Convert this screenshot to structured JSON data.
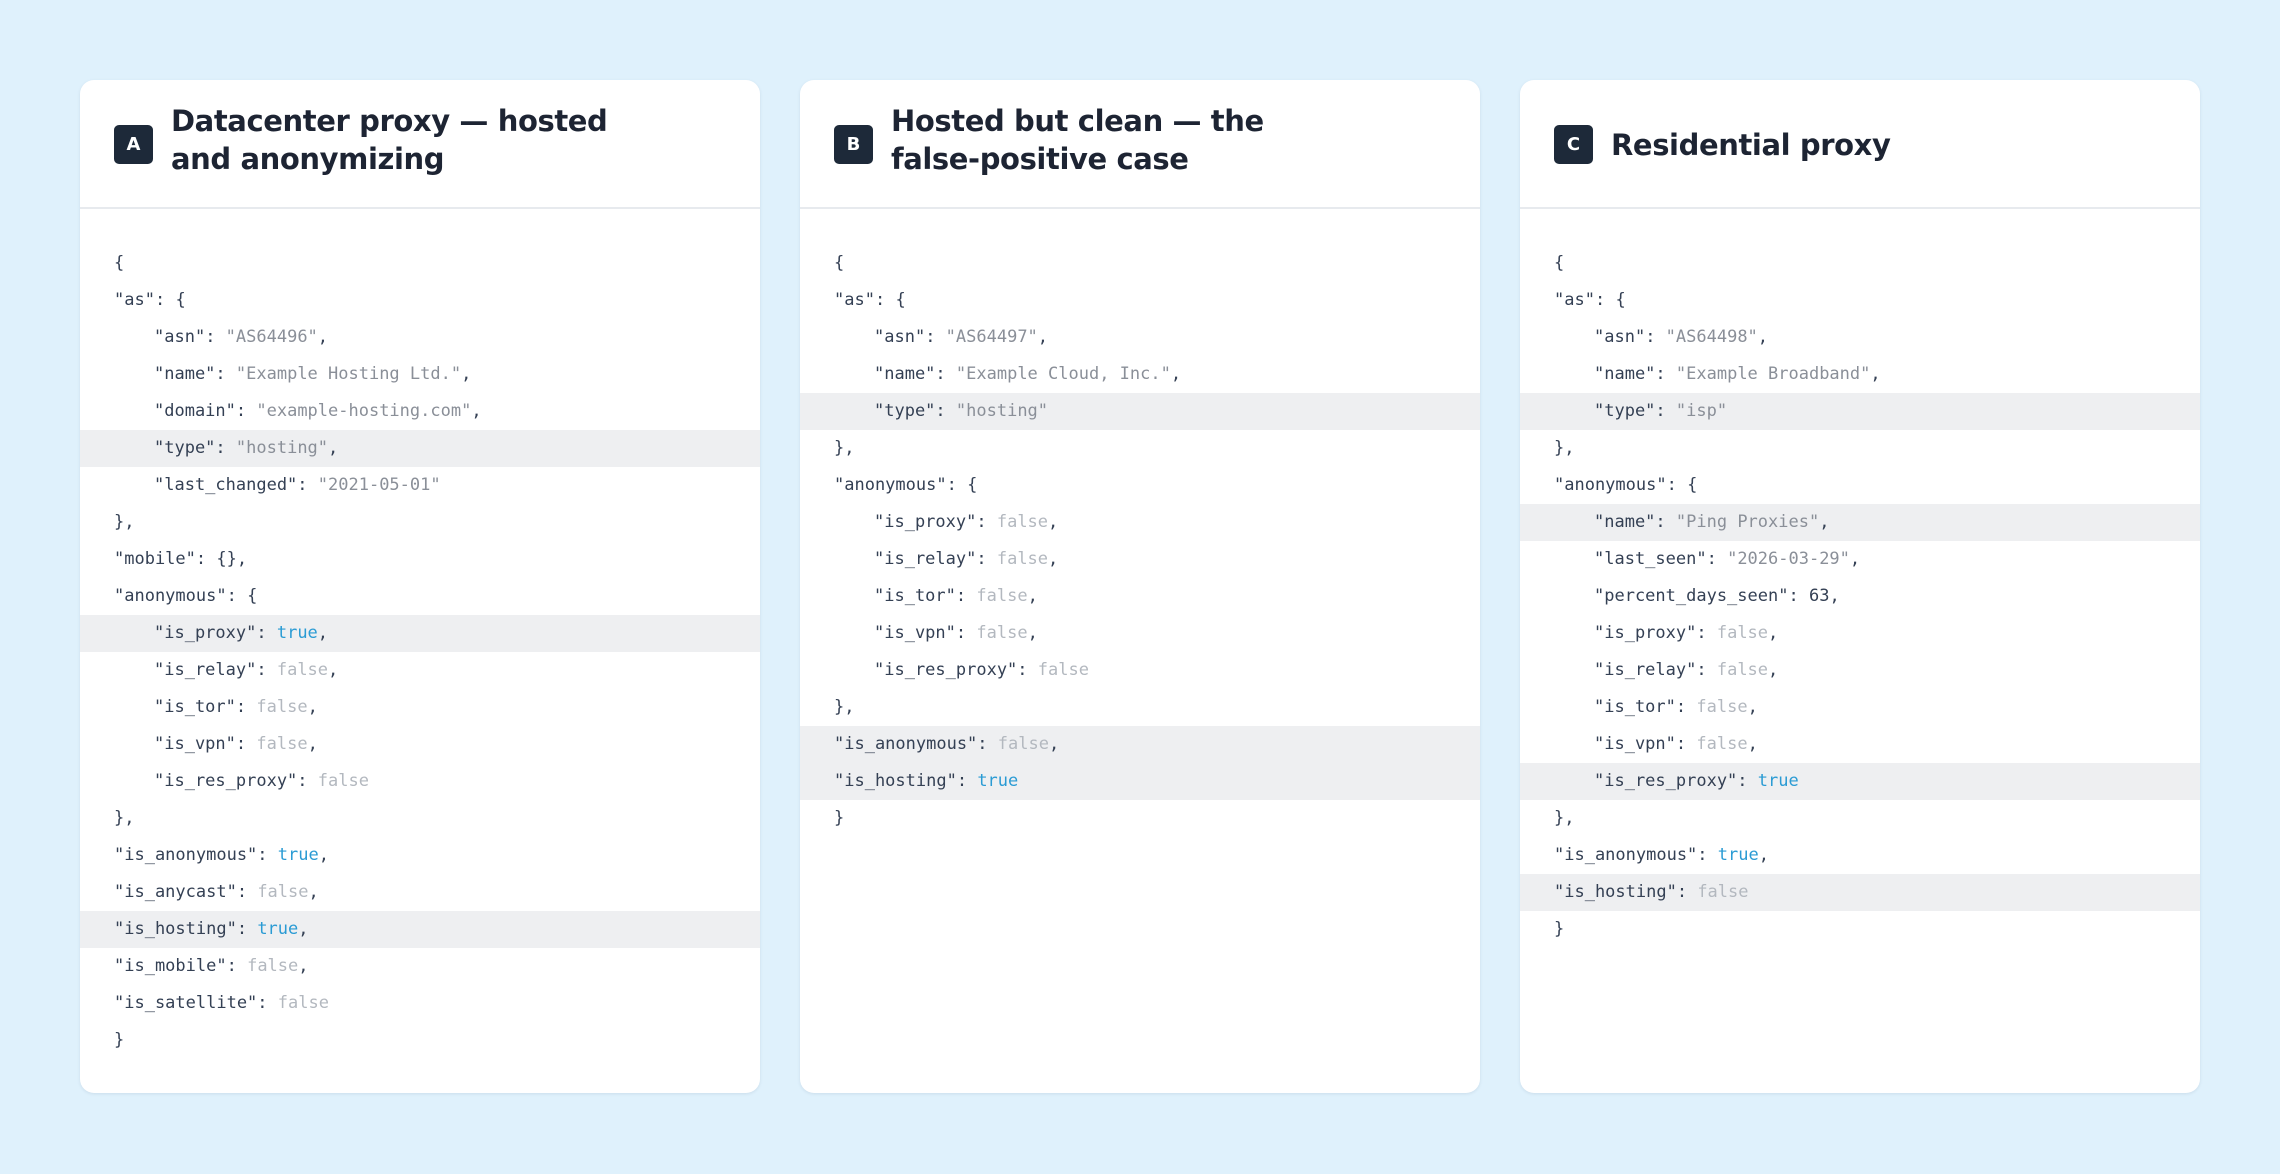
{
  "colors": {
    "background": "#dff1fc",
    "card": "#ffffff",
    "badge": "#1d2939",
    "highlight": "#eeeff1",
    "key": "#344054",
    "string": "#8a8f98",
    "true": "#2a9bd4",
    "false": "#b3b8bf"
  },
  "cards": [
    {
      "badge": "A",
      "title_lines": [
        "Datacenter proxy — hosted",
        "and anonymizing"
      ],
      "lines": [
        {
          "indent": 0,
          "hl": false,
          "key": "",
          "value": "",
          "vtype": "",
          "text": "{"
        },
        {
          "indent": 0,
          "hl": false,
          "key": "\"as\"",
          "value": "",
          "vtype": "",
          "text": "{"
        },
        {
          "indent": 1,
          "hl": false,
          "key": "\"asn\"",
          "value": "\"AS64496\"",
          "vtype": "string",
          "text": ","
        },
        {
          "indent": 1,
          "hl": false,
          "key": "\"name\"",
          "value": "\"Example Hosting Ltd.\"",
          "vtype": "string",
          "text": ","
        },
        {
          "indent": 1,
          "hl": false,
          "key": "\"domain\"",
          "value": "\"example-hosting.com\"",
          "vtype": "string",
          "text": ","
        },
        {
          "indent": 1,
          "hl": true,
          "key": "\"type\"",
          "value": "\"hosting\"",
          "vtype": "string",
          "text": ","
        },
        {
          "indent": 1,
          "hl": false,
          "key": "\"last_changed\"",
          "value": "\"2021-05-01\"",
          "vtype": "string",
          "text": ""
        },
        {
          "indent": 0,
          "hl": false,
          "key": "",
          "value": "",
          "vtype": "",
          "text": "},"
        },
        {
          "indent": 0,
          "hl": false,
          "key": "\"mobile\"",
          "value": "",
          "vtype": "",
          "text": "{},"
        },
        {
          "indent": 0,
          "hl": false,
          "key": "\"anonymous\"",
          "value": "",
          "vtype": "",
          "text": "{"
        },
        {
          "indent": 1,
          "hl": true,
          "key": "\"is_proxy\"",
          "value": "true",
          "vtype": "true",
          "text": ","
        },
        {
          "indent": 1,
          "hl": false,
          "key": "\"is_relay\"",
          "value": "false",
          "vtype": "false",
          "text": ","
        },
        {
          "indent": 1,
          "hl": false,
          "key": "\"is_tor\"",
          "value": "false",
          "vtype": "false",
          "text": ","
        },
        {
          "indent": 1,
          "hl": false,
          "key": "\"is_vpn\"",
          "value": "false",
          "vtype": "false",
          "text": ","
        },
        {
          "indent": 1,
          "hl": false,
          "key": "\"is_res_proxy\"",
          "value": "false",
          "vtype": "false",
          "text": ""
        },
        {
          "indent": 0,
          "hl": false,
          "key": "",
          "value": "",
          "vtype": "",
          "text": "},"
        },
        {
          "indent": 0,
          "hl": false,
          "key": "\"is_anonymous\"",
          "value": "true",
          "vtype": "true",
          "text": ","
        },
        {
          "indent": 0,
          "hl": false,
          "key": "\"is_anycast\"",
          "value": "false",
          "vtype": "false",
          "text": ","
        },
        {
          "indent": 0,
          "hl": true,
          "key": "\"is_hosting\"",
          "value": "true",
          "vtype": "true",
          "text": ","
        },
        {
          "indent": 0,
          "hl": false,
          "key": "\"is_mobile\"",
          "value": "false",
          "vtype": "false",
          "text": ","
        },
        {
          "indent": 0,
          "hl": false,
          "key": "\"is_satellite\"",
          "value": "false",
          "vtype": "false",
          "text": ""
        },
        {
          "indent": 0,
          "hl": false,
          "key": "",
          "value": "",
          "vtype": "",
          "text": "}"
        }
      ]
    },
    {
      "badge": "B",
      "title_lines": [
        "Hosted but clean — the",
        "false-positive case"
      ],
      "lines": [
        {
          "indent": 0,
          "hl": false,
          "key": "",
          "value": "",
          "vtype": "",
          "text": "{"
        },
        {
          "indent": 0,
          "hl": false,
          "key": "\"as\"",
          "value": "",
          "vtype": "",
          "text": "{"
        },
        {
          "indent": 1,
          "hl": false,
          "key": "\"asn\"",
          "value": "\"AS64497\"",
          "vtype": "string",
          "text": ","
        },
        {
          "indent": 1,
          "hl": false,
          "key": "\"name\"",
          "value": "\"Example Cloud, Inc.\"",
          "vtype": "string",
          "text": ","
        },
        {
          "indent": 1,
          "hl": true,
          "key": "\"type\"",
          "value": "\"hosting\"",
          "vtype": "string",
          "text": ""
        },
        {
          "indent": 0,
          "hl": false,
          "key": "",
          "value": "",
          "vtype": "",
          "text": "},"
        },
        {
          "indent": 0,
          "hl": false,
          "key": "\"anonymous\"",
          "value": "",
          "vtype": "",
          "text": "{"
        },
        {
          "indent": 1,
          "hl": false,
          "key": "\"is_proxy\"",
          "value": "false",
          "vtype": "false",
          "text": ","
        },
        {
          "indent": 1,
          "hl": false,
          "key": "\"is_relay\"",
          "value": "false",
          "vtype": "false",
          "text": ","
        },
        {
          "indent": 1,
          "hl": false,
          "key": "\"is_tor\"",
          "value": "false",
          "vtype": "false",
          "text": ","
        },
        {
          "indent": 1,
          "hl": false,
          "key": "\"is_vpn\"",
          "value": "false",
          "vtype": "false",
          "text": ","
        },
        {
          "indent": 1,
          "hl": false,
          "key": "\"is_res_proxy\"",
          "value": "false",
          "vtype": "false",
          "text": ""
        },
        {
          "indent": 0,
          "hl": false,
          "key": "",
          "value": "",
          "vtype": "",
          "text": "},"
        },
        {
          "indent": 0,
          "hl": true,
          "key": "\"is_anonymous\"",
          "value": "false",
          "vtype": "false",
          "text": ","
        },
        {
          "indent": 0,
          "hl": true,
          "key": "\"is_hosting\"",
          "value": "true",
          "vtype": "true",
          "text": ""
        },
        {
          "indent": 0,
          "hl": false,
          "key": "",
          "value": "",
          "vtype": "",
          "text": "}"
        }
      ]
    },
    {
      "badge": "C",
      "title_lines": [
        "Residential proxy"
      ],
      "lines": [
        {
          "indent": 0,
          "hl": false,
          "key": "",
          "value": "",
          "vtype": "",
          "text": "{"
        },
        {
          "indent": 0,
          "hl": false,
          "key": "\"as\"",
          "value": "",
          "vtype": "",
          "text": "{"
        },
        {
          "indent": 1,
          "hl": false,
          "key": "\"asn\"",
          "value": "\"AS64498\"",
          "vtype": "string",
          "text": ","
        },
        {
          "indent": 1,
          "hl": false,
          "key": "\"name\"",
          "value": "\"Example Broadband\"",
          "vtype": "string",
          "text": ","
        },
        {
          "indent": 1,
          "hl": true,
          "key": "\"type\"",
          "value": "\"isp\"",
          "vtype": "string",
          "text": ""
        },
        {
          "indent": 0,
          "hl": false,
          "key": "",
          "value": "",
          "vtype": "",
          "text": "},"
        },
        {
          "indent": 0,
          "hl": false,
          "key": "\"anonymous\"",
          "value": "",
          "vtype": "",
          "text": "{"
        },
        {
          "indent": 1,
          "hl": true,
          "key": "\"name\"",
          "value": "\"Ping Proxies\"",
          "vtype": "string",
          "text": ","
        },
        {
          "indent": 1,
          "hl": false,
          "key": "\"last_seen\"",
          "value": "\"2026-03-29\"",
          "vtype": "string",
          "text": ","
        },
        {
          "indent": 1,
          "hl": false,
          "key": "\"percent_days_seen\"",
          "value": "63",
          "vtype": "number",
          "text": ","
        },
        {
          "indent": 1,
          "hl": false,
          "key": "\"is_proxy\"",
          "value": "false",
          "vtype": "false",
          "text": ","
        },
        {
          "indent": 1,
          "hl": false,
          "key": "\"is_relay\"",
          "value": "false",
          "vtype": "false",
          "text": ","
        },
        {
          "indent": 1,
          "hl": false,
          "key": "\"is_tor\"",
          "value": "false",
          "vtype": "false",
          "text": ","
        },
        {
          "indent": 1,
          "hl": false,
          "key": "\"is_vpn\"",
          "value": "false",
          "vtype": "false",
          "text": ","
        },
        {
          "indent": 1,
          "hl": true,
          "key": "\"is_res_proxy\"",
          "value": "true",
          "vtype": "true",
          "text": ""
        },
        {
          "indent": 0,
          "hl": false,
          "key": "",
          "value": "",
          "vtype": "",
          "text": "},"
        },
        {
          "indent": 0,
          "hl": false,
          "key": "\"is_anonymous\"",
          "value": "true",
          "vtype": "true",
          "text": ","
        },
        {
          "indent": 0,
          "hl": true,
          "key": "\"is_hosting\"",
          "value": "false",
          "vtype": "false",
          "text": ""
        },
        {
          "indent": 0,
          "hl": false,
          "key": "",
          "value": "",
          "vtype": "",
          "text": "}"
        }
      ]
    }
  ]
}
